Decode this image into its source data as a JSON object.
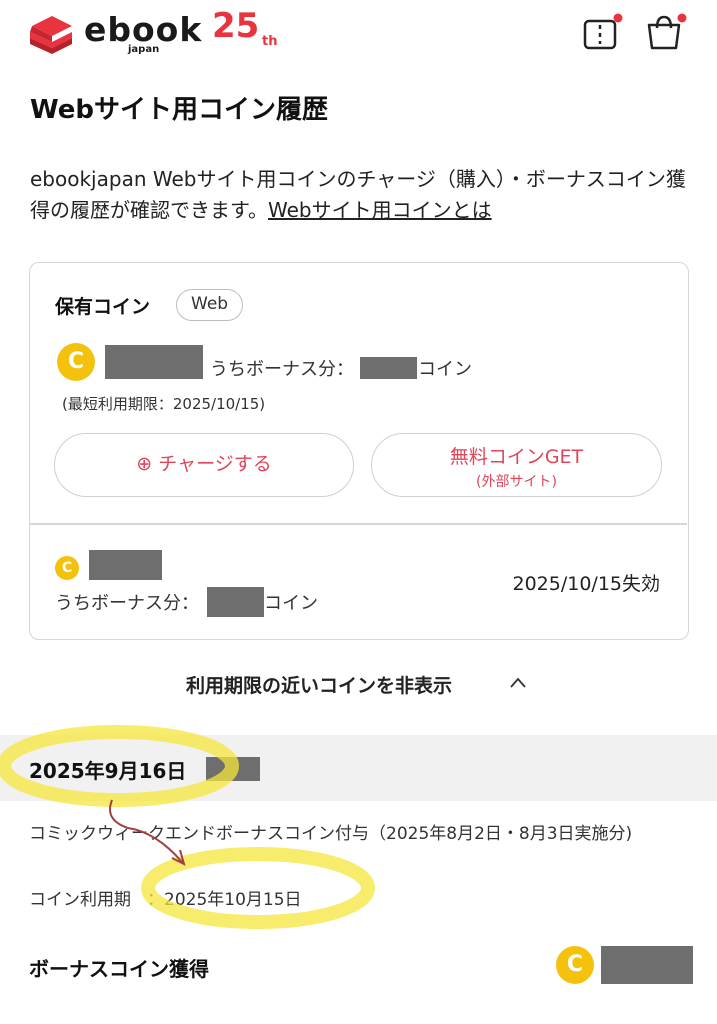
{
  "header": {
    "logo_text": "ebook",
    "logo_sub": "japan",
    "anniversary": "25",
    "anniversary_suffix": "th",
    "brand_color": "#e9343f"
  },
  "page_title": "Webサイト用コイン履歴",
  "description": {
    "text": "ebookjapan Webサイト用コインのチャージ（購入）・ボーナスコイン獲得の履歴が確認できます。",
    "link": "Webサイト用コインとは"
  },
  "coin_card": {
    "title": "保有コイン",
    "badge": "Web",
    "coin_icon": "C",
    "bonus_label": "うちボーナス分：",
    "coin_unit": "コイン",
    "expiry": "(最短利用期限：2025/10/15)",
    "charge_button": "チャージする",
    "free_button_line1": "無料コインGET",
    "free_button_line2": "(外部サイト)",
    "accent_color": "#e0455a",
    "expiring": {
      "bonus_label": "うちボーナス分：",
      "coin_unit": "コイン",
      "expire_date": "2025/10/15失効"
    }
  },
  "toggle_label": "利用期限の近いコインを非表示",
  "history": {
    "date": "2025年9月16日",
    "description": "コミックウィークエンドボーナスコイン付与（2025年8月2日・8月3日実施分)",
    "expiry_label": "コイン利用期",
    "expiry_value": "：2025年10月15日",
    "kind": "ボーナスコイン獲得",
    "coin_icon": "C"
  }
}
